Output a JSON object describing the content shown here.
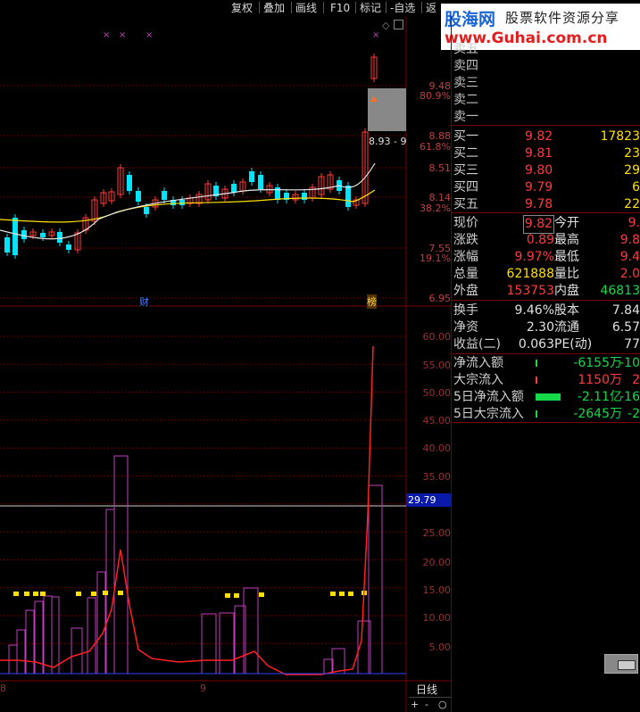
{
  "toolbar": {
    "items": [
      "复权",
      "叠加",
      "画线",
      "F10",
      "标记",
      "-自选",
      "返"
    ]
  },
  "banner": {
    "brand": "股海网",
    "slogan": "股票软件资源分享",
    "url": "www.Guhai.com.cn"
  },
  "price_axis": [
    "9.48",
    "80.9%",
    "8.88",
    "61.8%",
    "8.51",
    "8.14",
    "38.2%",
    "7.55",
    "19.1%",
    "6.95"
  ],
  "fib_box_label": "8.93 - 9",
  "event_markers": {
    "cai": "财",
    "bang": "榜"
  },
  "indicator_axis": [
    "60.00",
    "55.00",
    "50.00",
    "45.00",
    "40.00",
    "35.00",
    "30.00",
    "25.00",
    "20.00",
    "15.00",
    "10.00",
    "5.00"
  ],
  "indicator_current": "29.79",
  "date_axis": [
    "8",
    "9"
  ],
  "period_tab": "日线",
  "zoom": {
    "plus": "+",
    "minus": "-",
    "circle": "○"
  },
  "order_book": {
    "sell": [
      {
        "label": "卖五",
        "price": "",
        "vol": ""
      },
      {
        "label": "卖四",
        "price": "",
        "vol": ""
      },
      {
        "label": "卖三",
        "price": "",
        "vol": ""
      },
      {
        "label": "卖二",
        "price": "",
        "vol": ""
      },
      {
        "label": "卖一",
        "price": "",
        "vol": ""
      }
    ],
    "buy": [
      {
        "label": "买一",
        "price": "9.82",
        "vol": "17823"
      },
      {
        "label": "买二",
        "price": "9.81",
        "vol": "23"
      },
      {
        "label": "买三",
        "price": "9.80",
        "vol": "29"
      },
      {
        "label": "买四",
        "price": "9.79",
        "vol": "6"
      },
      {
        "label": "买五",
        "price": "9.78",
        "vol": "22"
      }
    ]
  },
  "quote": {
    "rows": [
      {
        "l1": "现价",
        "v1": "9.82",
        "l2": "今开",
        "v2": "9."
      },
      {
        "l1": "涨跌",
        "v1": "0.89",
        "l2": "最高",
        "v2": "9.8"
      },
      {
        "l1": "涨幅",
        "v1": "9.97%",
        "l2": "最低",
        "v2": "9.4"
      },
      {
        "l1": "总量",
        "v1": "621888",
        "l2": "量比",
        "v2": "2.0"
      },
      {
        "l1": "外盘",
        "v1": "153753",
        "l2": "内盘",
        "v2": "46813"
      }
    ],
    "rows2": [
      {
        "l1": "换手",
        "v1": "9.46%",
        "l2": "股本",
        "v2": "7.84"
      },
      {
        "l1": "净资",
        "v1": "2.30",
        "l2": "流通",
        "v2": "6.57"
      },
      {
        "l1": "收益(二)",
        "v1": "0.063",
        "l2": "PE(动)",
        "v2": "77"
      }
    ]
  },
  "fund_flow": [
    {
      "label": "净流入额",
      "v1": "-6155万",
      "v2": "-10",
      "bar": 0.08
    },
    {
      "label": "大宗流入",
      "v1": "1150万",
      "v2": "2",
      "bar": 0.01
    },
    {
      "label": "5日净流入额",
      "v1": "-2.11亿",
      "v2": "-16",
      "bar": 1.0
    },
    {
      "label": "5日大宗流入",
      "v1": "-2645万",
      "v2": "-2",
      "bar": 0.04
    }
  ],
  "colors": {
    "up": "#ff3b3b",
    "down": "#00e5ff",
    "grid": "#7a0000",
    "ma_white": "#e8e8e8",
    "ma_yellow": "#ffe000",
    "accent_blue": "#1a64d6"
  }
}
